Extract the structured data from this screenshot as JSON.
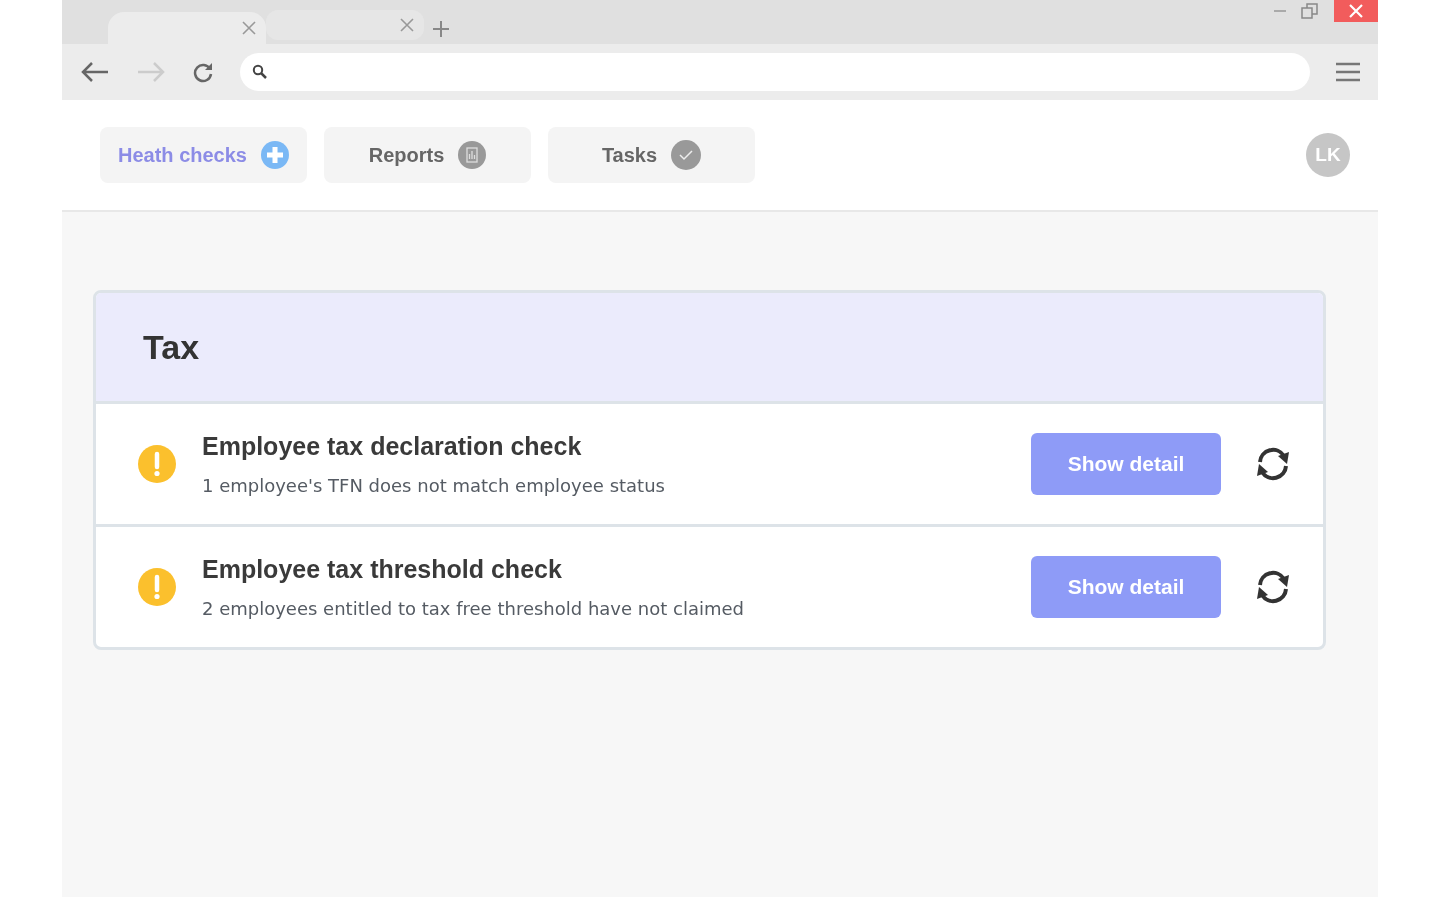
{
  "browser": {
    "tabs": [
      {
        "selected": true
      },
      {
        "selected": false
      }
    ]
  },
  "nav_tabs": [
    {
      "label": "Heath checks",
      "kind": "add",
      "selected": true
    },
    {
      "label": "Reports",
      "kind": "report",
      "selected": false
    },
    {
      "label": "Tasks",
      "kind": "check",
      "selected": false
    }
  ],
  "avatar": {
    "initials": "LK"
  },
  "section": {
    "title": "Tax",
    "checks": [
      {
        "kind": "warning",
        "title": "Employee tax declaration check",
        "description": "1 employee's TFN does not match employee status",
        "button": "Show detail"
      },
      {
        "kind": "warning",
        "title": "Employee tax threshold check",
        "description": "2 employees entitled to tax free threshold have not claimed",
        "button": "Show detail"
      }
    ]
  }
}
